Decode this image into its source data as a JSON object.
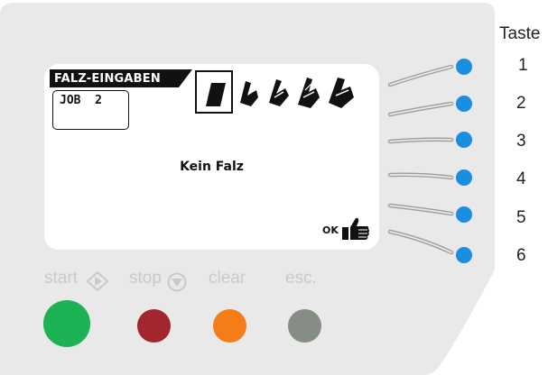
{
  "display": {
    "title": "FALZ-EINGABEN",
    "job_label": "JOB  2",
    "status_text": "Kein Falz",
    "ok_label": "OK",
    "fold_options": [
      "no-fold",
      "single-fold",
      "letter-fold",
      "z-fold",
      "double-parallel-fold"
    ],
    "selected_fold_index": 0
  },
  "softkeys": {
    "header": "Taste",
    "numbers": [
      "1",
      "2",
      "3",
      "4",
      "5",
      "6"
    ]
  },
  "controls": [
    {
      "label": "start",
      "icon": "start-diamond-icon",
      "color": "#1db254"
    },
    {
      "label": "stop",
      "icon": "stop-triangle-icon",
      "color": "#a3262e"
    },
    {
      "label": "clear",
      "icon": "",
      "color": "#f57c17"
    },
    {
      "label": "esc.",
      "icon": "",
      "color": "#858d84"
    }
  ],
  "colors": {
    "panel": "#e8e9e8",
    "softkey_dot": "#1a8ee0"
  }
}
